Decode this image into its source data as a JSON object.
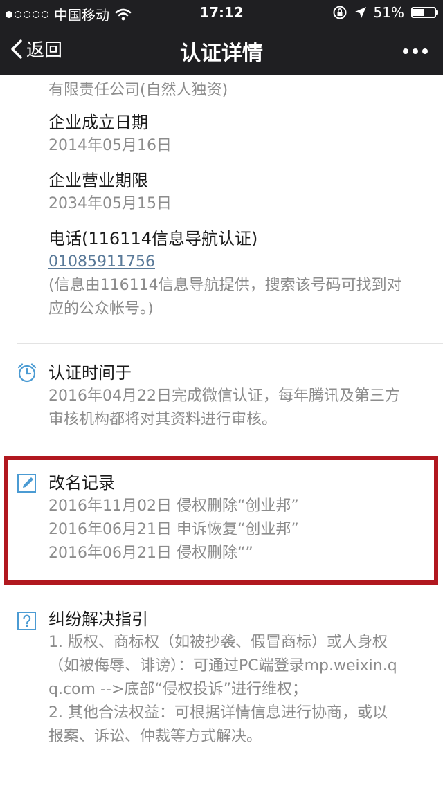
{
  "status_bar": {
    "carrier": "中国移动",
    "time": "17:12",
    "battery": "51%",
    "battery_level": 0.51
  },
  "nav": {
    "back_label": "返回",
    "title": "认证详情"
  },
  "company_type": "有限责任公司(自然人独资)",
  "establish": {
    "label": "企业成立日期",
    "value": "2014年05月16日"
  },
  "term": {
    "label": "企业营业期限",
    "value": "2034年05月15日"
  },
  "phone": {
    "label": "电话(116114信息导航认证)",
    "number": "01085911756",
    "note_line1": "(信息由116114信息导航提供，搜索该号码可找到对",
    "note_line2": "应的公众帐号。)"
  },
  "cert_time": {
    "label": "认证时间于",
    "line1": "2016年04月22日完成微信认证，每年腾讯及第三方",
    "line2": "审核机构都将对其资料进行审核。"
  },
  "rename": {
    "label": "改名记录",
    "records": [
      "2016年11月02日 侵权删除“创业邦”",
      "2016年06月21日 申诉恢复“创业邦”",
      "2016年06月21日 侵权删除“”"
    ]
  },
  "dispute": {
    "label": "纠纷解决指引",
    "lines": [
      "1. 版权、商标权（如被抄袭、假冒商标）或人身权",
      "（如被侮辱、诽谤）：可通过PC端登录mp.weixin.q",
      "q.com -->底部“侵权投诉”进行维权；",
      "2. 其他合法权益：可根据详情信息进行协商，或以",
      "报案、诉讼、仲裁等方式解决。"
    ]
  },
  "colors": {
    "topbar": "#1f1f22",
    "icon_blue": "#4b9bd3",
    "highlight_red": "#b1181f",
    "link": "#5a7a99"
  },
  "icons": {
    "alarm": "alarm-clock-icon",
    "edit": "pencil-edit-icon",
    "help": "question-mark-icon"
  }
}
